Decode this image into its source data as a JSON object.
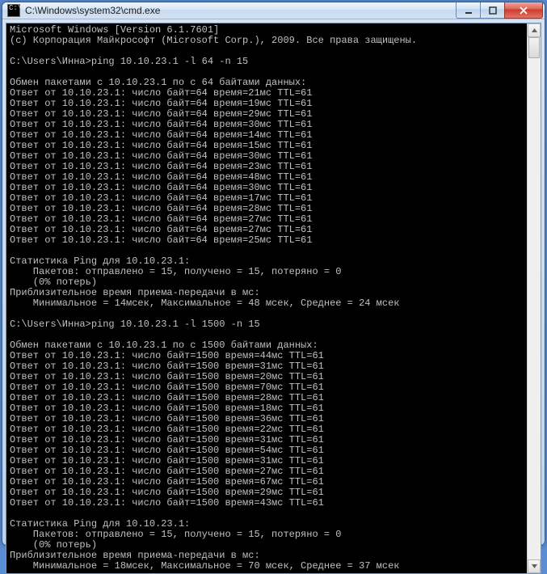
{
  "window": {
    "title": "C:\\Windows\\system32\\cmd.exe",
    "icon_label": "cmd-icon"
  },
  "console": {
    "header": [
      "Microsoft Windows [Version 6.1.7601]",
      "(c) Корпорация Майкрософт (Microsoft Corp.), 2009. Все права защищены.",
      ""
    ],
    "prompt1": "C:\\Users\\Инна>ping 10.10.23.1 -l 64 -n 15",
    "exch1_hdr": "Обмен пакетами с 10.10.23.1 по с 64 байтами данных:",
    "replies1": [
      "Ответ от 10.10.23.1: число байт=64 время=21мс TTL=61",
      "Ответ от 10.10.23.1: число байт=64 время=19мс TTL=61",
      "Ответ от 10.10.23.1: число байт=64 время=29мс TTL=61",
      "Ответ от 10.10.23.1: число байт=64 время=30мс TTL=61",
      "Ответ от 10.10.23.1: число байт=64 время=14мс TTL=61",
      "Ответ от 10.10.23.1: число байт=64 время=15мс TTL=61",
      "Ответ от 10.10.23.1: число байт=64 время=30мс TTL=61",
      "Ответ от 10.10.23.1: число байт=64 время=23мс TTL=61",
      "Ответ от 10.10.23.1: число байт=64 время=48мс TTL=61",
      "Ответ от 10.10.23.1: число байт=64 время=30мс TTL=61",
      "Ответ от 10.10.23.1: число байт=64 время=17мс TTL=61",
      "Ответ от 10.10.23.1: число байт=64 время=28мс TTL=61",
      "Ответ от 10.10.23.1: число байт=64 время=27мс TTL=61",
      "Ответ от 10.10.23.1: число байт=64 время=27мс TTL=61",
      "Ответ от 10.10.23.1: число байт=64 время=25мс TTL=61"
    ],
    "stats1": [
      "Статистика Ping для 10.10.23.1:",
      "    Пакетов: отправлено = 15, получено = 15, потеряно = 0",
      "    (0% потерь)",
      "Приблизительное время приема-передачи в мс:",
      "    Минимальное = 14мсек, Максимальное = 48 мсек, Среднее = 24 мсек"
    ],
    "prompt2": "C:\\Users\\Инна>ping 10.10.23.1 -l 1500 -n 15",
    "exch2_hdr": "Обмен пакетами с 10.10.23.1 по с 1500 байтами данных:",
    "replies2": [
      "Ответ от 10.10.23.1: число байт=1500 время=44мс TTL=61",
      "Ответ от 10.10.23.1: число байт=1500 время=31мс TTL=61",
      "Ответ от 10.10.23.1: число байт=1500 время=20мс TTL=61",
      "Ответ от 10.10.23.1: число байт=1500 время=70мс TTL=61",
      "Ответ от 10.10.23.1: число байт=1500 время=28мс TTL=61",
      "Ответ от 10.10.23.1: число байт=1500 время=18мс TTL=61",
      "Ответ от 10.10.23.1: число байт=1500 время=36мс TTL=61",
      "Ответ от 10.10.23.1: число байт=1500 время=22мс TTL=61",
      "Ответ от 10.10.23.1: число байт=1500 время=31мс TTL=61",
      "Ответ от 10.10.23.1: число байт=1500 время=54мс TTL=61",
      "Ответ от 10.10.23.1: число байт=1500 время=31мс TTL=61",
      "Ответ от 10.10.23.1: число байт=1500 время=27мс TTL=61",
      "Ответ от 10.10.23.1: число байт=1500 время=67мс TTL=61",
      "Ответ от 10.10.23.1: число байт=1500 время=29мс TTL=61",
      "Ответ от 10.10.23.1: число байт=1500 время=43мс TTL=61"
    ],
    "stats2": [
      "Статистика Ping для 10.10.23.1:",
      "    Пакетов: отправлено = 15, получено = 15, потеряно = 0",
      "    (0% потерь)",
      "Приблизительное время приема-передачи в мс:",
      "    Минимальное = 18мсек, Максимальное = 70 мсек, Среднее = 37 мсек"
    ]
  }
}
